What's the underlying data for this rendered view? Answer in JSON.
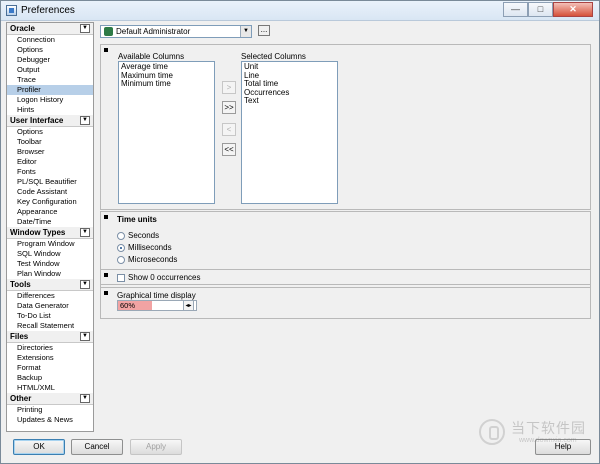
{
  "window": {
    "title": "Preferences",
    "buttons": {
      "minimize": "—",
      "maximize": "□",
      "close": "✕"
    }
  },
  "sidebar": {
    "groups": [
      {
        "title": "Oracle",
        "items": [
          "Connection",
          "Options",
          "Debugger",
          "Output",
          "Trace",
          "Profiler",
          "Logon History",
          "Hints"
        ]
      },
      {
        "title": "User Interface",
        "items": [
          "Options",
          "Toolbar",
          "Browser",
          "Editor",
          "Fonts",
          "PL/SQL Beautifier",
          "Code Assistant",
          "Key Configuration",
          "Appearance",
          "Date/Time"
        ]
      },
      {
        "title": "Window Types",
        "items": [
          "Program Window",
          "SQL Window",
          "Test Window",
          "Plan Window"
        ]
      },
      {
        "title": "Tools",
        "items": [
          "Differences",
          "Data Generator",
          "To-Do List",
          "Recall Statement"
        ]
      },
      {
        "title": "Files",
        "items": [
          "Directories",
          "Extensions",
          "Format",
          "Backup",
          "HTML/XML"
        ]
      },
      {
        "title": "Other",
        "items": [
          "Printing",
          "Updates & News"
        ]
      }
    ],
    "selected": "Profiler",
    "collapse_icon": "▼"
  },
  "profile": {
    "selected": "Default Administrator",
    "more_button": "..."
  },
  "columns": {
    "available_label": "Available Columns",
    "available": [
      "Average time",
      "Maximum time",
      "Minimum time"
    ],
    "selected_label": "Selected Columns",
    "selected": [
      "Unit",
      "Line",
      "Total time",
      "Occurrences",
      "Text"
    ],
    "buttons": {
      "add": ">",
      "add_all": ">>",
      "remove": "<",
      "remove_all": "<<"
    }
  },
  "time_units": {
    "title": "Time units",
    "options": [
      "Seconds",
      "Milliseconds",
      "Microseconds"
    ],
    "selected": "Milliseconds"
  },
  "occurrences": {
    "label": "Show 0 occurrences",
    "checked": false
  },
  "graphical": {
    "label": "Graphical time display",
    "value": "60%",
    "color": "#f2a3a3"
  },
  "footer": {
    "ok": "OK",
    "cancel": "Cancel",
    "apply": "Apply",
    "help": "Help"
  },
  "watermark": {
    "text": "当下软件园",
    "url": "www.downxia.com"
  }
}
